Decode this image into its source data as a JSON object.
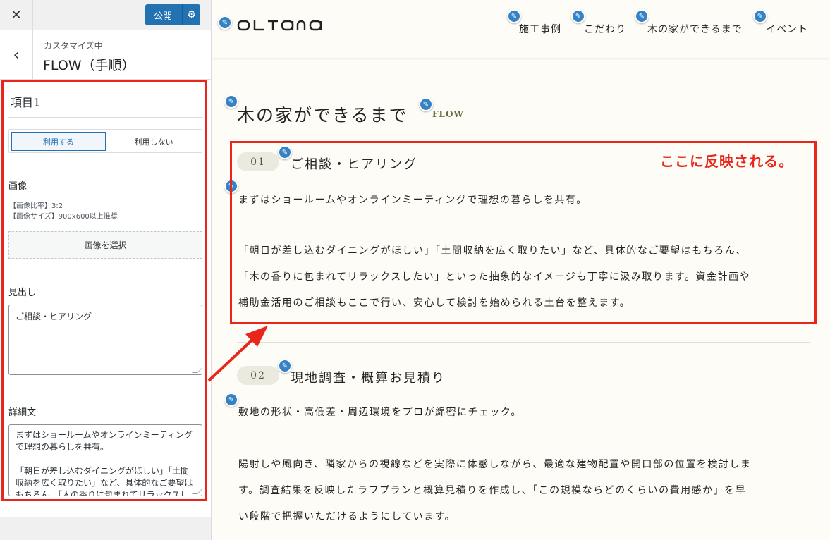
{
  "sidebar": {
    "close_icon": "close-icon",
    "publish_label": "公開",
    "breadcrumb": "カスタマイズ中",
    "title": "FLOW（手順）",
    "section_title": "項目1",
    "toggle": {
      "on": "利用する",
      "off": "利用しない"
    },
    "image_label": "画像",
    "image_note_1": "【画像比率】3:2",
    "image_note_2": "【画像サイズ】900x600以上推奨",
    "image_button": "画像を選択",
    "heading_label": "見出し",
    "heading_value": "ご相談・ヒアリング",
    "detail_label": "詳細文",
    "detail_lines": [
      "まずはショールームやオンラインミーティング",
      "で理想の暮らしを共有。",
      "",
      "「朝日が差し込むダイニングがほしい」「土間",
      "収納を広く取りたい」など、具体的なご要望は",
      "もちろん、「木の香りに包まれてリラックスし"
    ]
  },
  "site": {
    "logo": "OLTANA",
    "nav": [
      "施工事例",
      "こだわり",
      "木の家ができるまで",
      "イベント"
    ],
    "page_title": "木の家ができるまで",
    "page_sub": "FLOW",
    "steps": [
      {
        "num": "01",
        "title": "ご相談・ヒアリング",
        "lines": [
          "まずはショールームやオンラインミーティングで理想の暮らしを共有。",
          "",
          "「朝日が差し込むダイニングがほしい」「土間収納を広く取りたい」など、具体的なご要望はもちろん、",
          "「木の香りに包まれてリラックスしたい」といった抽象的なイメージも丁寧に汲み取ります。資金計画や",
          "補助金活用のご相談もここで行い、安心して検討を始められる土台を整えます。"
        ]
      },
      {
        "num": "02",
        "title": "現地調査・概算お見積り",
        "lines": [
          "敷地の形状・高低差・周辺環境をプロが綿密にチェック。",
          "",
          "陽射しや風向き、隣家からの視線などを実際に体感しながら、最適な建物配置や開口部の位置を検討しま",
          "す。調査結果を反映したラフプランと概算見積りを作成し、「この規模ならどのくらいの費用感か」を早",
          "い段階で把握いただけるようにしています。"
        ]
      }
    ]
  },
  "annotation": {
    "callout": "ここに反映される。",
    "color": "#e8261b"
  },
  "colors": {
    "accent": "#2271b1",
    "pencil": "#3582c4",
    "preview_bg": "#fdfcf6"
  }
}
